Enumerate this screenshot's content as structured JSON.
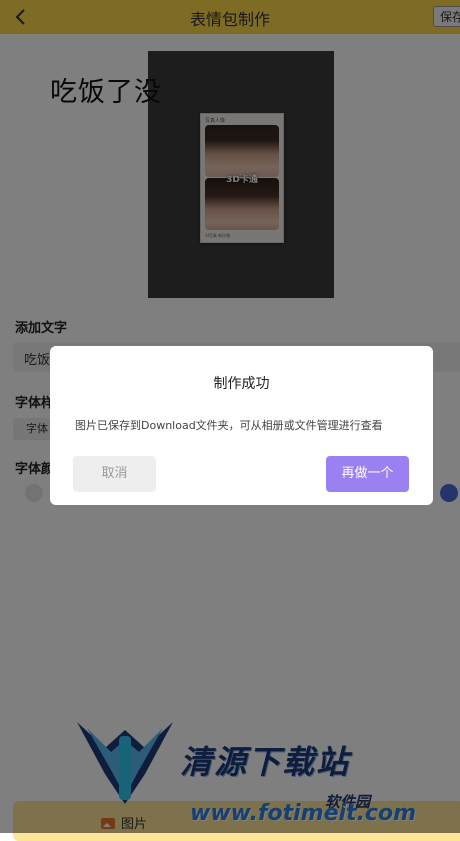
{
  "header": {
    "title": "表情包制作",
    "save_label": "保存"
  },
  "canvas": {
    "overlay_text": "吃饭了没",
    "meme": {
      "top_text": "写真人像",
      "caption": "3D卡通",
      "footer": "AI写真 新风格"
    }
  },
  "controls": {
    "add_text_label": "添加文字",
    "text_input_value": "吃饭",
    "font_style_label": "字体样",
    "font_chip": "字体",
    "font_color_label": "字体颜",
    "swatch_colors": [
      "#e6e6e6",
      "#4a6bd8"
    ]
  },
  "bottom_bar": {
    "picture_tab": "图片"
  },
  "watermark": {
    "brand": "清源下载站",
    "url": "www.fotimeit.com",
    "site": "软件园"
  },
  "dialog": {
    "title": "制作成功",
    "message": "图片已保存到Download文件夹，可从相册或文件管理进行查看",
    "cancel_label": "取消",
    "again_label": "再做一个"
  },
  "colors": {
    "accent_yellow": "#fcd94a",
    "primary_purple": "#9b80f2"
  }
}
